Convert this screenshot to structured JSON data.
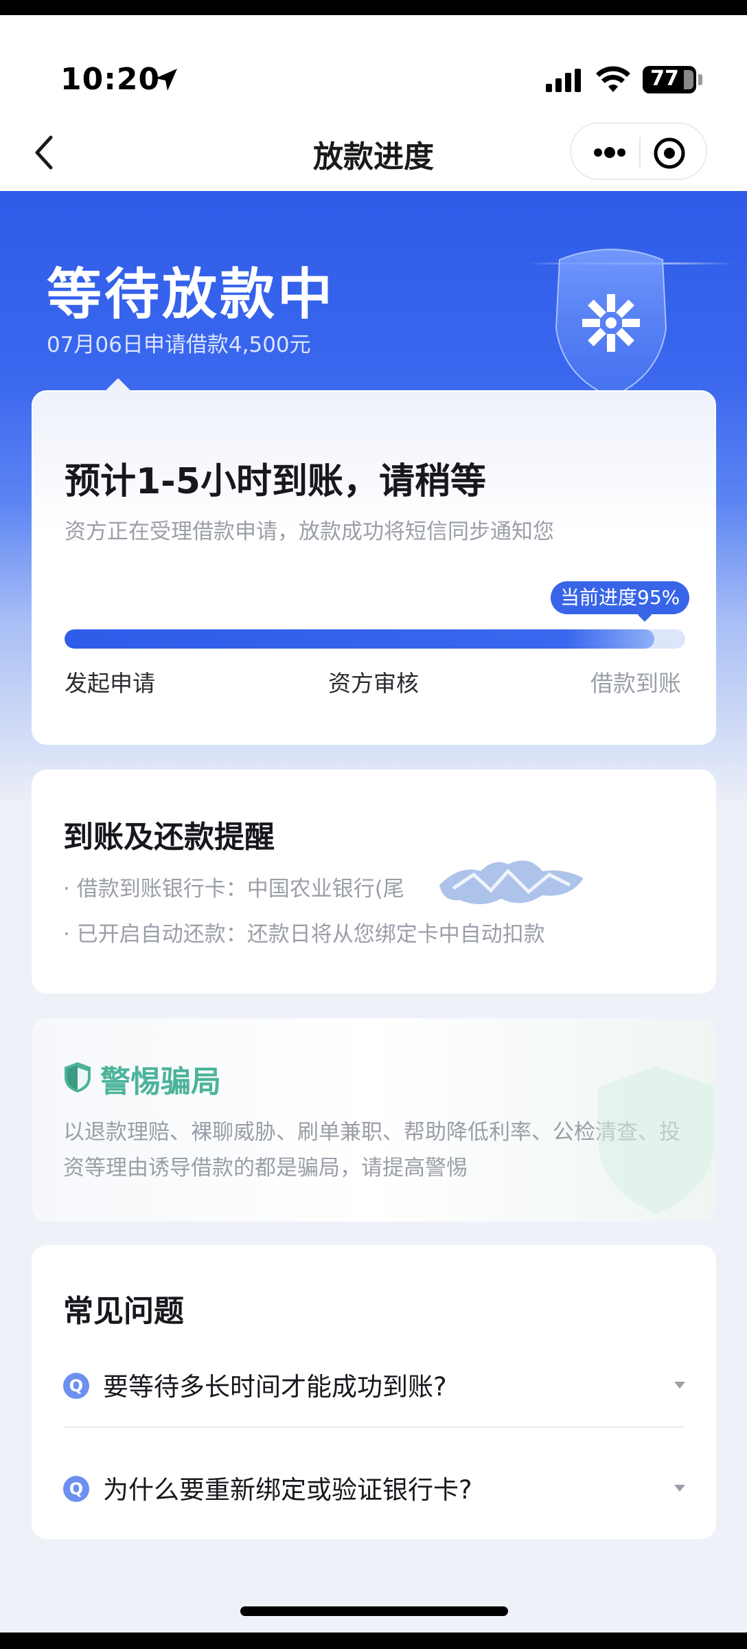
{
  "status_bar": {
    "time": "10:20",
    "battery": "77",
    "icons": [
      "location-arrow-icon",
      "cellular-signal-icon",
      "wifi-icon",
      "battery-icon"
    ]
  },
  "nav": {
    "title": "放款进度",
    "icons": [
      "back-arrow-icon",
      "more-dots-icon",
      "close-target-icon"
    ]
  },
  "hero": {
    "title": "等待放款中",
    "subtitle": "07月06日申请借款4,500元",
    "icon": "shield-logo-icon"
  },
  "progress": {
    "title": "预计1-5小时到账，请稍等",
    "subtitle": "资方正在受理借款申请，放款成功将短信同步通知您",
    "badge": "当前进度95%",
    "percent": 95,
    "steps": [
      "发起申请",
      "资方审核",
      "借款到账"
    ]
  },
  "reminder": {
    "title": "到账及还款提醒",
    "items": [
      "· 借款到账银行卡：中国农业银行(尾",
      "· 已开启自动还款：还款日将从您绑定卡中自动扣款"
    ]
  },
  "warning": {
    "title": "警惕骗局",
    "text": "以退款理赔、裸聊威胁、刷单兼职、帮助降低利率、公检清查、投资等理由诱导借款的都是骗局，请提高警惕",
    "icon": "shield-check-icon"
  },
  "faq": {
    "title": "常见问题",
    "badge": "Q",
    "items": [
      "要等待多长时间才能成功到账?",
      "为什么要重新绑定或验证银行卡?"
    ]
  },
  "colors": {
    "primary_blue": "#2f5ce8",
    "warning_green": "#4cb39a",
    "muted_text": "#9a9ea8"
  }
}
